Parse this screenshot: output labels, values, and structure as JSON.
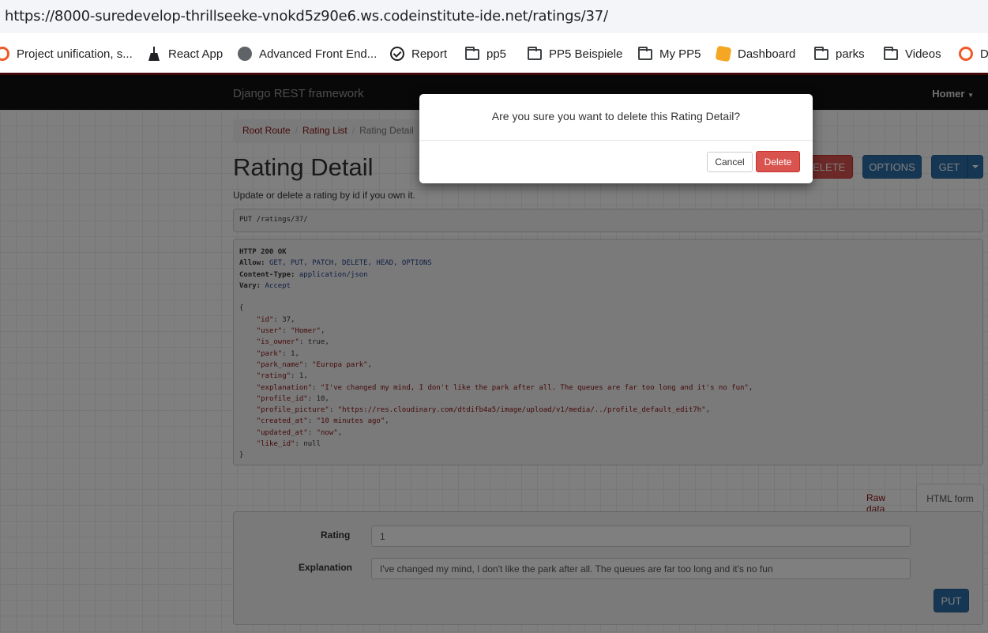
{
  "browser": {
    "url": "https://8000-suredevelop-thrillseeke-vnokd5z90e6.ws.codeinstitute-ide.net/ratings/37/",
    "bookmarks": [
      {
        "label": "Project unification, s...",
        "icon": "ring-icon"
      },
      {
        "label": "React App",
        "icon": "broom-icon"
      },
      {
        "label": "Advanced Front End...",
        "icon": "globe-icon"
      },
      {
        "label": "Report",
        "icon": "check-circle-icon"
      },
      {
        "label": "pp5",
        "icon": "folder-icon"
      },
      {
        "label": "PP5 Beispiele",
        "icon": "folder-icon"
      },
      {
        "label": "My PP5",
        "icon": "folder-icon"
      },
      {
        "label": "Dashboard",
        "icon": "g-logo-icon"
      },
      {
        "label": "parks",
        "icon": "folder-icon"
      },
      {
        "label": "Videos",
        "icon": "folder-icon"
      },
      {
        "label": "D",
        "icon": "ring-icon"
      }
    ]
  },
  "navbar": {
    "brand": "Django REST framework",
    "user": "Homer"
  },
  "breadcrumb": {
    "root": "Root Route",
    "list": "Rating List",
    "current": "Rating Detail"
  },
  "page": {
    "title": "Rating Detail",
    "description": "Update or delete a rating by id if you own it.",
    "buttons": {
      "delete": "DELETE",
      "options": "OPTIONS",
      "get": "GET"
    },
    "request": "PUT /ratings/37/"
  },
  "response": {
    "status": "HTTP 200 OK",
    "headers": [
      {
        "name": "Allow:",
        "value": "GET, PUT, PATCH, DELETE, HEAD, OPTIONS"
      },
      {
        "name": "Content-Type:",
        "value": "application/json"
      },
      {
        "name": "Vary:",
        "value": "Accept"
      }
    ],
    "body": {
      "id": "37",
      "user": "\"Homer\"",
      "is_owner": "true",
      "park": "1",
      "park_name": "\"Europa park\"",
      "rating": "1",
      "explanation": "\"I've changed my mind, I don't like the park after all. The queues are far too long and it's no fun\"",
      "profile_id": "10",
      "profile_picture": "\"https://res.cloudinary.com/dtdifb4a5/image/upload/v1/media/../profile_default_edit7h\"",
      "created_at": "\"10 minutes ago\"",
      "updated_at": "\"now\"",
      "like_id": "null"
    }
  },
  "tabs": {
    "raw": "Raw data",
    "html": "HTML form"
  },
  "form": {
    "rating_label": "Rating",
    "rating_value": "1",
    "explanation_label": "Explanation",
    "explanation_value": "I've changed my mind, I don't like the park after all. The queues are far too long and it's no fun",
    "submit": "PUT"
  },
  "modal": {
    "message": "Are you sure you want to delete this Rating Detail?",
    "cancel": "Cancel",
    "delete": "Delete"
  }
}
